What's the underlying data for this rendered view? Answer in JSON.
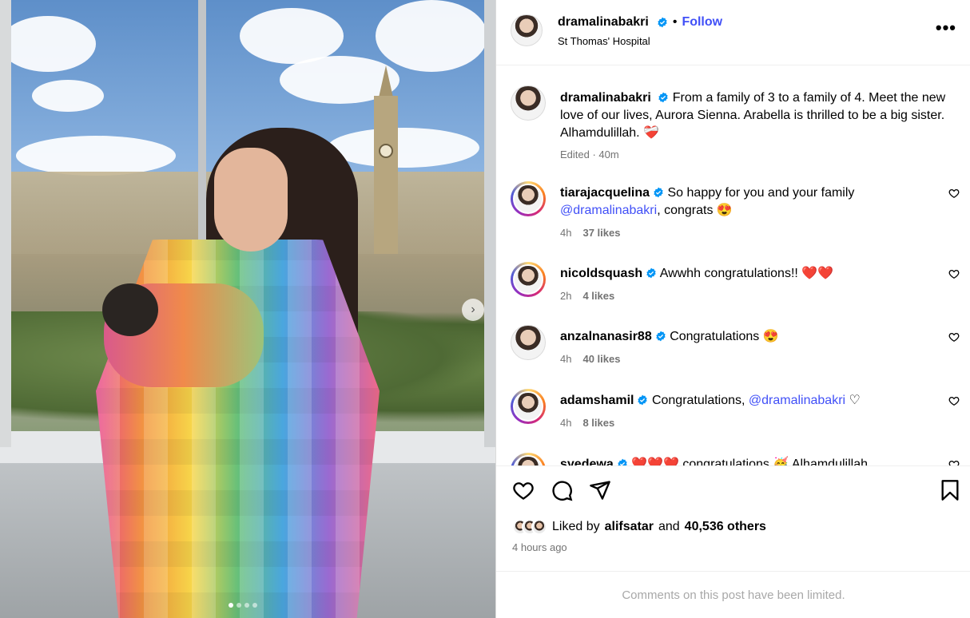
{
  "post": {
    "username": "dramalinabakri",
    "location": "St Thomas' Hospital",
    "follow_label": "Follow",
    "separator": "•",
    "more": "•••"
  },
  "caption": {
    "username": "dramalinabakri",
    "text": "From a family of 3 to a family of 4. Meet the new love of our lives, Aurora Sienna. Arabella is thrilled to be a big sister. Alhamdulillah.",
    "emoji": "❤️‍🩹",
    "meta": "Edited · 40m"
  },
  "comments": [
    {
      "username": "tiarajacquelina",
      "text": "So happy for you and your family",
      "mention": "@dramalinabakri",
      "text_after": ", congrats 😍",
      "time": "4h",
      "likes": "37 likes",
      "story_ring": true
    },
    {
      "username": "nicoldsquash",
      "text": "Awwhh congratulations!!",
      "mention": "",
      "text_after": " ❤️❤️",
      "time": "2h",
      "likes": "4 likes",
      "story_ring": true
    },
    {
      "username": "anzalnanasir88",
      "text": "Congratulations 😍",
      "mention": "",
      "text_after": "",
      "time": "4h",
      "likes": "40 likes",
      "story_ring": false
    },
    {
      "username": "adamshamil",
      "text": "Congratulations,",
      "mention": "@dramalinabakri",
      "text_after": " ♡",
      "time": "4h",
      "likes": "8 likes",
      "story_ring": true
    },
    {
      "username": "syedewa",
      "text": "❤️❤️❤️ congratulations 🥳 Alhamdulillah",
      "mention": "",
      "text_after": "",
      "time": "",
      "likes": "",
      "story_ring": true
    }
  ],
  "likes": {
    "prefix": "Liked by",
    "user": "alifsatar",
    "conj": "and",
    "others": "40,536 others"
  },
  "timestamp": "4 hours ago",
  "footer": "Comments on this post have been limited.",
  "carousel": {
    "current": 1,
    "total": 4
  },
  "colors": {
    "accent": "#4150f7",
    "verified": "#0095f6",
    "heart": "#e0245e"
  },
  "icons": [
    "heart-icon",
    "comment-icon",
    "share-icon",
    "bookmark-icon",
    "more-icon",
    "verified-icon",
    "chevron-right-icon"
  ]
}
